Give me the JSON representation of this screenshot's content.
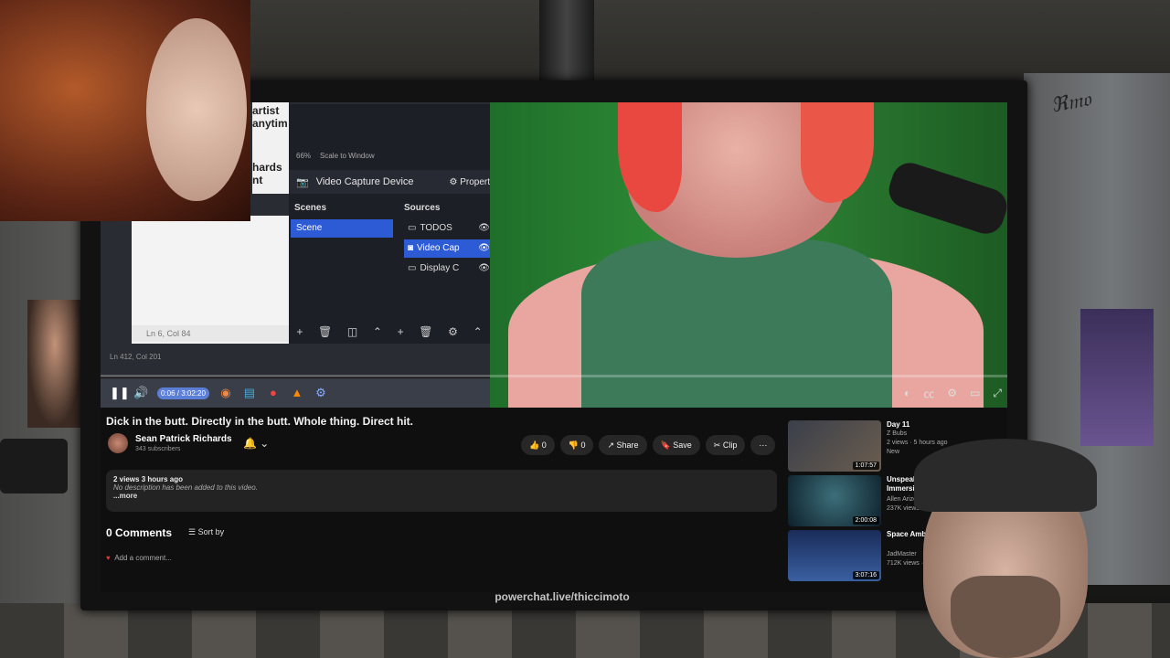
{
  "stream": {
    "watermark": "powerchat.live/thiccimoto"
  },
  "notepad": {
    "artist_text": [
      "artist",
      "anytim",
      "hards",
      "nt"
    ],
    "status": "Ln 6, Col 84",
    "status2": "Ln 412, Col 201"
  },
  "obs": {
    "zoom": "66%",
    "scale": "Scale to Window",
    "capture_label": "Video Capture Device",
    "properties_label": "Propert",
    "scenes_header": "Scenes",
    "sources_header": "Sources",
    "scenes": [
      "Scene"
    ],
    "sources": [
      {
        "label": "TODOS"
      },
      {
        "label": "Video Cap"
      },
      {
        "label": "Display C"
      }
    ]
  },
  "player": {
    "time": "0:06 / 3:02:20"
  },
  "video": {
    "title": "Dick in the butt. Directly in the butt. Whole thing. Direct hit.",
    "channel": "Sean Patrick Richards",
    "subscribers": "343 subscribers",
    "likes": "0",
    "dislikes": "0",
    "share": "Share",
    "save": "Save",
    "clip": "Clip",
    "views_meta": "2 views  3 hours ago",
    "description": "No description has been added to this video.",
    "more": "...more",
    "comments_count": "0 Comments",
    "sort_by": "Sort by",
    "add_comment": "Add a comment..."
  },
  "suggestions": [
    {
      "title": "Day 11",
      "channel": "Z Bubs",
      "meta": "2 views · 5 hours ago",
      "badge": "New",
      "duration": "1:07:57"
    },
    {
      "title": "Unspeakable Dark Music - Immersive",
      "channel": "Allen Arize",
      "meta": "237K views · 1 year ago",
      "badge": "",
      "duration": "2:00:08"
    },
    {
      "title": "Space Ambient Field by Sonus",
      "channel": "JadMaster",
      "meta": "712K views · 2 years ago",
      "badge": "",
      "duration": "3:07:16"
    }
  ],
  "icons": {
    "play": "pause-icon",
    "bell": "bell-icon"
  }
}
